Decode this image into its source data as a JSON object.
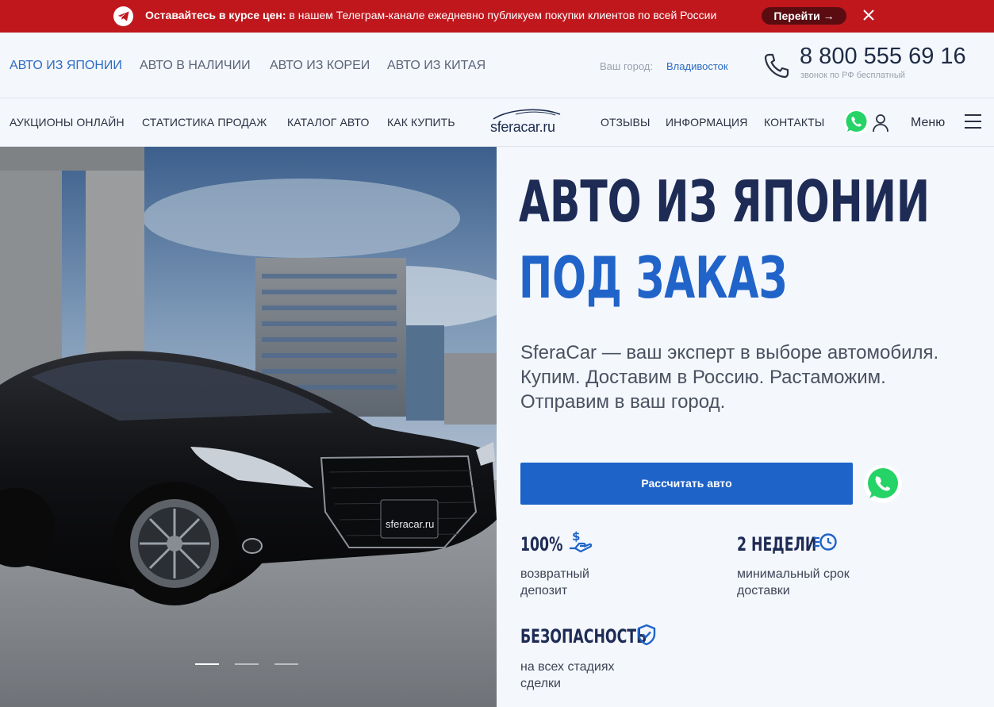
{
  "banner": {
    "bold": "Оставайтесь в курсе цен:",
    "text": " в нашем Телеграм-канале ежедневно публикуем покупки клиентов по всей России",
    "button": "Перейти →"
  },
  "nav_top": {
    "items": [
      "АВТО ИЗ ЯПОНИИ",
      "АВТО В НАЛИЧИИ",
      "АВТО ИЗ КОРЕИ",
      "АВТО ИЗ КИТАЯ"
    ],
    "city_label": "Ваш город:",
    "city": "Владивосток",
    "phone": "8 800 555 69 16",
    "phone_note": "звонок по РФ бесплатный"
  },
  "nav_main": {
    "left": [
      "АУКЦИОНЫ ОНЛАЙН",
      "СТАТИСТИКА ПРОДАЖ",
      "КАТАЛОГ АВТО",
      "КАК КУПИТЬ"
    ],
    "logo": "sferacar.ru",
    "right": [
      "ОТЗЫВЫ",
      "ИНФОРМАЦИЯ",
      "КОНТАКТЫ"
    ],
    "menu": "Меню"
  },
  "hero": {
    "title_line1": "АВТО ИЗ ЯПОНИИ",
    "title_line2": "ПОД ЗАКАЗ",
    "lead_line1": "SferaCar — ваш эксперт в выборе автомобиля.",
    "lead_line2": "Купим. Доставим в Россию. Растаможим.",
    "lead_line3": "Отправим в ваш город.",
    "cta": "Рассчитать авто",
    "plate": "sferacar.ru"
  },
  "features": [
    {
      "title": "100%",
      "desc": "возвратный депозит",
      "icon": "deposit-icon"
    },
    {
      "title": "2 НЕДЕЛИ",
      "desc": "минимальный срок доставки",
      "icon": "clock-icon"
    },
    {
      "title": "БЕЗОПАСНОСТЬ",
      "desc": "на всех стадиях сделки",
      "icon": "shield-icon"
    }
  ],
  "colors": {
    "banner": "#c0171d",
    "accent": "#1e63c8",
    "title": "#1d2b55",
    "whatsapp": "#25d366"
  }
}
